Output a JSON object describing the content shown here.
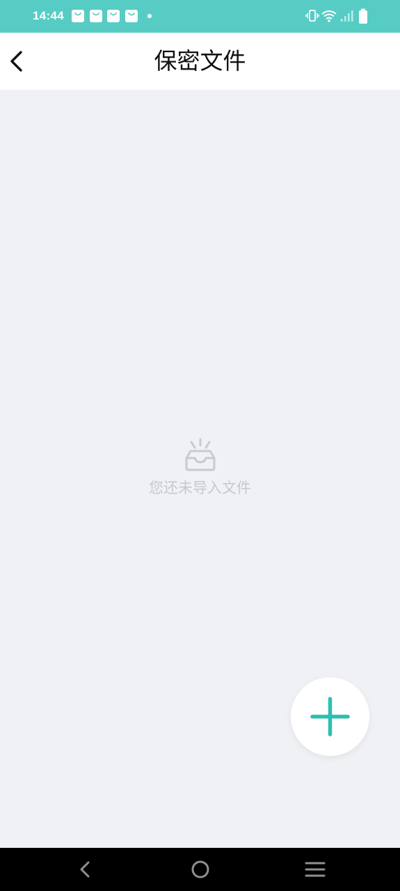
{
  "status_bar": {
    "time": "14:44",
    "notification_icons": [
      "shopping-bag-icon",
      "shopping-bag-icon",
      "shopping-bag-icon",
      "shopping-bag-icon",
      "dot-icon"
    ],
    "system_icons": [
      "vibrate-icon",
      "wifi-icon",
      "signal-icon",
      "battery-icon"
    ],
    "background_color": "#57ccc4"
  },
  "header": {
    "back_icon": "chevron-left-icon",
    "title": "保密文件"
  },
  "empty_state": {
    "icon": "empty-inbox-icon",
    "message": "您还未导入文件"
  },
  "fab": {
    "icon": "plus-icon",
    "accent_color": "#2ebfb3"
  },
  "nav_bar": {
    "buttons": [
      "back-nav-icon",
      "home-nav-icon",
      "recents-nav-icon"
    ]
  }
}
